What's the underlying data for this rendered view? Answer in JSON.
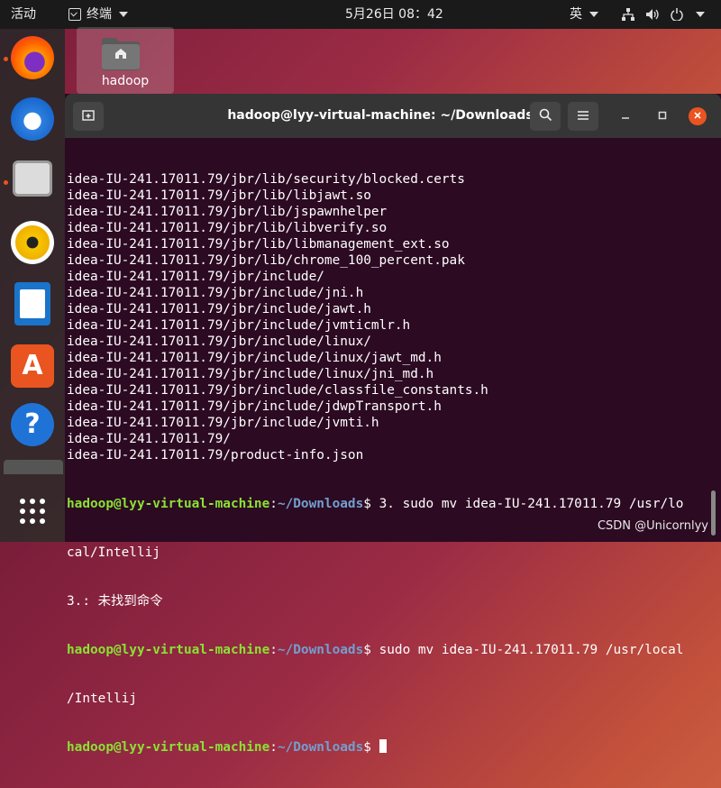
{
  "topbar": {
    "activities": "活动",
    "app_name": "终端",
    "clock": "5月26日 08：42",
    "ime": "英"
  },
  "desktop": {
    "home_label": "hadoop"
  },
  "dock": {
    "items": [
      "firefox-icon",
      "thunderbird-icon",
      "files-icon",
      "rhythmbox-icon",
      "libreoffice-writer-icon",
      "software-center-icon",
      "help-icon",
      "show-apps-icon"
    ]
  },
  "terminal": {
    "title": "hadoop@lyy-virtual-machine: ~/Downloads",
    "lines": [
      "idea-IU-241.17011.79/jbr/lib/security/blocked.certs",
      "idea-IU-241.17011.79/jbr/lib/libjawt.so",
      "idea-IU-241.17011.79/jbr/lib/jspawnhelper",
      "idea-IU-241.17011.79/jbr/lib/libverify.so",
      "idea-IU-241.17011.79/jbr/lib/libmanagement_ext.so",
      "idea-IU-241.17011.79/jbr/lib/chrome_100_percent.pak",
      "idea-IU-241.17011.79/jbr/include/",
      "idea-IU-241.17011.79/jbr/include/jni.h",
      "idea-IU-241.17011.79/jbr/include/jawt.h",
      "idea-IU-241.17011.79/jbr/include/jvmticmlr.h",
      "idea-IU-241.17011.79/jbr/include/linux/",
      "idea-IU-241.17011.79/jbr/include/linux/jawt_md.h",
      "idea-IU-241.17011.79/jbr/include/linux/jni_md.h",
      "idea-IU-241.17011.79/jbr/include/classfile_constants.h",
      "idea-IU-241.17011.79/jbr/include/jdwpTransport.h",
      "idea-IU-241.17011.79/jbr/include/jvmti.h",
      "idea-IU-241.17011.79/",
      "idea-IU-241.17011.79/product-info.json"
    ],
    "prompt_user": "hadoop@lyy-virtual-machine",
    "prompt_sep": ":",
    "prompt_path": "~/Downloads",
    "prompt_dollar": "$ ",
    "cmd1": "3. sudo mv idea-IU-241.17011.79 /usr/lo",
    "cmd1_wrap": "cal/Intellij",
    "err": "3.: 未找到命令",
    "cmd2": "sudo mv idea-IU-241.17011.79 /usr/local",
    "cmd2_wrap": "/Intellij"
  },
  "watermark": "CSDN @Unicornlyy"
}
